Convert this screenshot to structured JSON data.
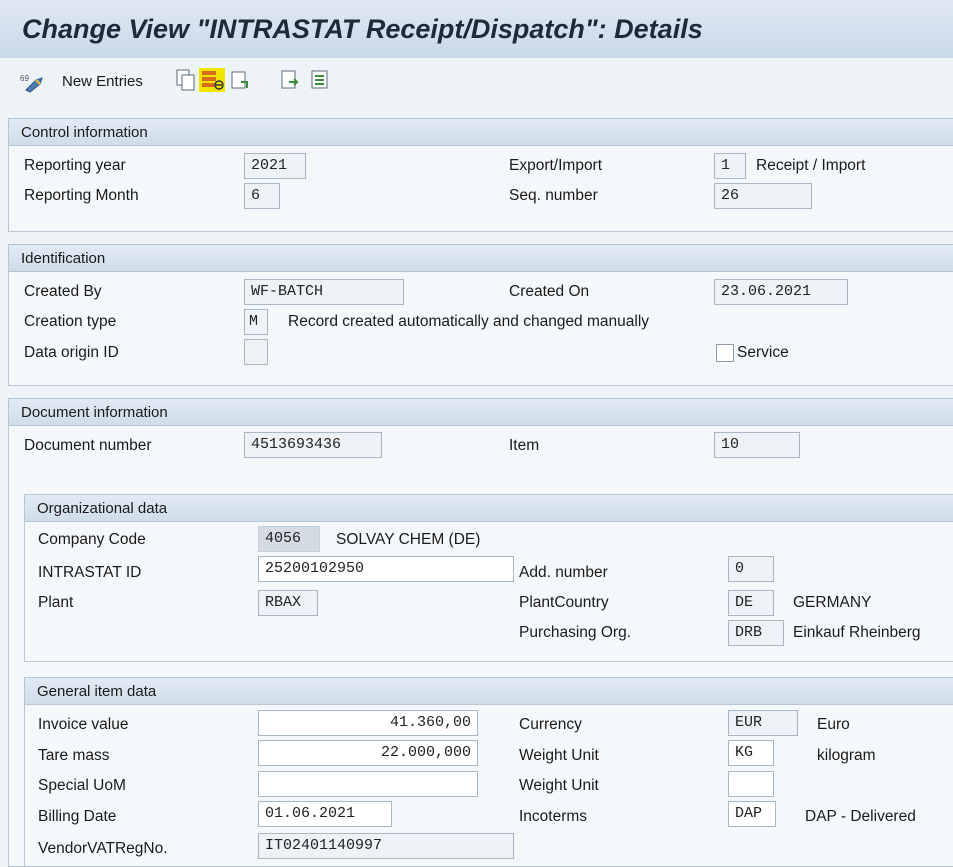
{
  "title": "Change View \"INTRASTAT Receipt/Dispatch\": Details",
  "toolbar": {
    "new_entries_label": "New Entries",
    "icons": [
      "display-change-icon",
      "copy-icon",
      "delete-icon",
      "undo-icon",
      "previous-entry-icon",
      "next-entry-icon"
    ]
  },
  "control": {
    "title": "Control information",
    "reporting_year_label": "Reporting year",
    "reporting_year": "2021",
    "reporting_month_label": "Reporting Month",
    "reporting_month": "6",
    "export_import_label": "Export/Import",
    "export_import": "1",
    "export_import_text": "Receipt / Import",
    "seq_number_label": "Seq. number",
    "seq_number": "26"
  },
  "identification": {
    "title": "Identification",
    "created_by_label": "Created By",
    "created_by": "WF-BATCH",
    "created_on_label": "Created On",
    "created_on": "23.06.2021",
    "creation_type_label": "Creation type",
    "creation_type": "M",
    "creation_type_text": "Record created automatically and changed manually",
    "data_origin_label": "Data origin ID",
    "data_origin": "",
    "service_label": "Service",
    "service_checked": false
  },
  "document": {
    "title": "Document information",
    "document_number_label": "Document number",
    "document_number": "4513693436",
    "item_label": "Item",
    "item": "10"
  },
  "org": {
    "title": "Organizational data",
    "company_code_label": "Company Code",
    "company_code": "4056",
    "company_name": "SOLVAY CHEM (DE)",
    "intrastat_id_label": "INTRASTAT ID",
    "intrastat_id": "25200102950",
    "add_number_label": "Add. number",
    "add_number": "0",
    "plant_label": "Plant",
    "plant": "RBAX",
    "plant_country_label": "PlantCountry",
    "plant_country": "DE",
    "plant_country_text": "GERMANY",
    "purch_org_label": "Purchasing Org.",
    "purch_org": "DRB",
    "purch_org_text": "Einkauf Rheinberg"
  },
  "general": {
    "title": "General item data",
    "invoice_value_label": "Invoice value",
    "invoice_value": "41.360,00",
    "currency_label": "Currency",
    "currency": "EUR",
    "currency_text": "Euro",
    "tare_mass_label": "Tare mass",
    "tare_mass": "22.000,000",
    "weight_unit_label": "Weight Unit",
    "weight_unit": "KG",
    "weight_unit_text": "kilogram",
    "special_uom_label": "Special UoM",
    "special_uom": "",
    "weight_unit2_label": "Weight Unit",
    "weight_unit2": "",
    "billing_date_label": "Billing Date",
    "billing_date": "01.06.2021",
    "incoterms_label": "Incoterms",
    "incoterms": "DAP",
    "incoterms_text": "DAP - Delivered",
    "vendor_vat_label": "VendorVATRegNo.",
    "vendor_vat": "IT02401140997"
  },
  "colors": {
    "highlight": "#f2e600",
    "title_bg": "#d3e0ec",
    "panel_head": "#d8e4ef"
  }
}
